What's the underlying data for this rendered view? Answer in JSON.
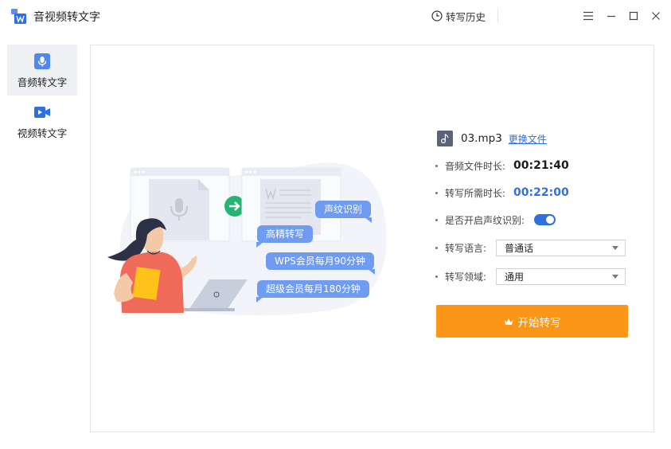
{
  "app": {
    "title": "音视频转文字"
  },
  "header": {
    "history_label": "转写历史"
  },
  "sidebar": {
    "items": [
      {
        "label": "音频转文字",
        "icon": "microphone-icon",
        "active": true
      },
      {
        "label": "视频转文字",
        "icon": "video-icon",
        "active": false
      }
    ]
  },
  "illustration": {
    "bubbles": [
      "声纹识别",
      "高精转写",
      "WPS会员每月90分钟",
      "超级会员每月180分钟"
    ]
  },
  "file": {
    "name": "03.mp3",
    "change_label": "更换文件"
  },
  "info": {
    "duration_label": "音频文件时长:",
    "duration_value": "00:21:40",
    "required_label": "转写所需时长:",
    "required_value": "00:22:00",
    "voiceprint_label": "是否开启声纹识别:",
    "voiceprint_enabled": true,
    "language_label": "转写语言:",
    "language_value": "普通话",
    "domain_label": "转写领域:",
    "domain_value": "通用"
  },
  "actions": {
    "start_label": "开始转写"
  },
  "colors": {
    "accent": "#2f6fe0",
    "start_button": "#fb9619",
    "bubble": "#6f9cf1"
  }
}
